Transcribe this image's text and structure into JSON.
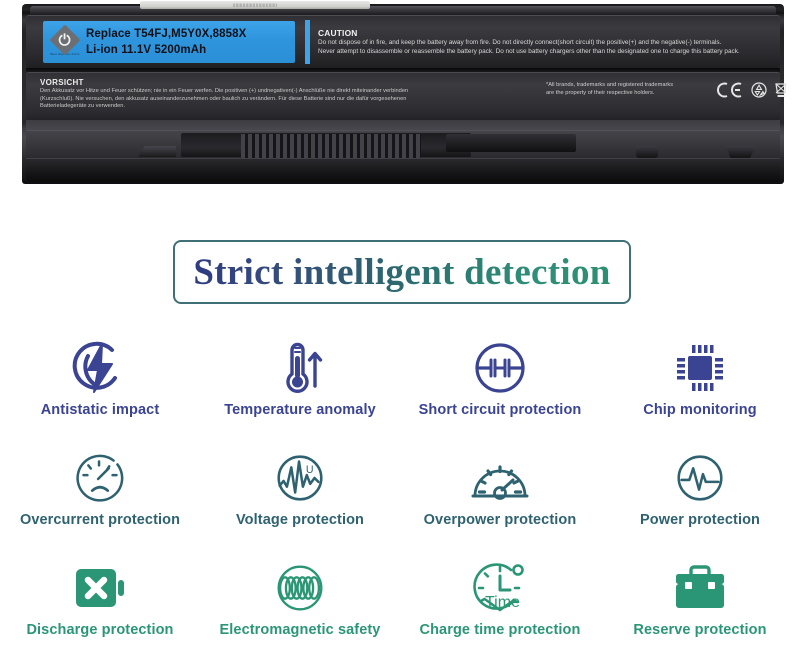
{
  "product_photo": {
    "top_label_text": "|||||||||||||||||||||||||||||||",
    "sticker": {
      "brand_mark": "power-symbol",
      "brand_sub": "Best Replace Parts",
      "line1": "Replace T54FJ,M5Y0X,8858X",
      "line2": "Li-ion 11.1V 5200mAh"
    },
    "caution": {
      "title": "CAUTION",
      "line1": "Do not dispose of in fire, and keep the battery away from fire. Do not directly connect(short circuit) the positive(+) and the negative(-) terminals.",
      "line2": "Never attempt to disassemble or reassemble the battery pack. Do not use battery chargers other than the designated one to charge this battery pack."
    },
    "vorsicht": {
      "title": "VORSICHT",
      "line1": "Den Akkusatz vor Hitze und Feuer schützen; nie in ein Feuer werfen. Die positiven (+) undnegativen(-) Anschlüße nie direkt miteinander verbinden",
      "line2": "(Kurzschluß). Nie versuchen, den akkusatz auseinanderzunehmen oder baulich zu verändern. Für diese Batterie sind nur die dafür vorgesehenen",
      "line3": "Batterieladegeräte zu verwenden."
    },
    "trademark": {
      "line1": "*All brands, trademarks and registered trademarks",
      "line2": "are the property of their respective holders."
    },
    "cert_marks": [
      "ce-mark",
      "recycle-mark",
      "weee-crossed-bin-mark"
    ]
  },
  "banner": {
    "title": "Strict intelligent detection",
    "border_color": "#3f6f77",
    "gradient_from": "#2e3b80",
    "gradient_to": "#2b8f72"
  },
  "features": {
    "rows": [
      {
        "color": "#3b4493",
        "items": [
          {
            "icon": "antistatic-lightning-icon",
            "label": "Antistatic impact"
          },
          {
            "icon": "thermometer-icon",
            "label": "Temperature anomaly"
          },
          {
            "icon": "short-circuit-icon",
            "label": "Short circuit protection"
          },
          {
            "icon": "chip-icon",
            "label": "Chip   monitoring"
          }
        ]
      },
      {
        "color": "#2e6270",
        "items": [
          {
            "icon": "gauge-sad-icon",
            "label": "Overcurrent  protection"
          },
          {
            "icon": "waveform-voltage-icon",
            "label": "Voltage   protection"
          },
          {
            "icon": "speedometer-icon",
            "label": "Overpower   protection"
          },
          {
            "icon": "pulse-circle-icon",
            "label": "Power   protection"
          }
        ]
      },
      {
        "color": "#2b9677",
        "items": [
          {
            "icon": "battery-cross-icon",
            "label": "Discharge  protection"
          },
          {
            "icon": "electromagnetic-coil-icon",
            "label": "Electromagnetic safety"
          },
          {
            "icon": "charge-clock-time-icon",
            "label": "Charge  time  protection"
          },
          {
            "icon": "toolbox-icon",
            "label": "Reserve   protection"
          }
        ]
      }
    ]
  }
}
